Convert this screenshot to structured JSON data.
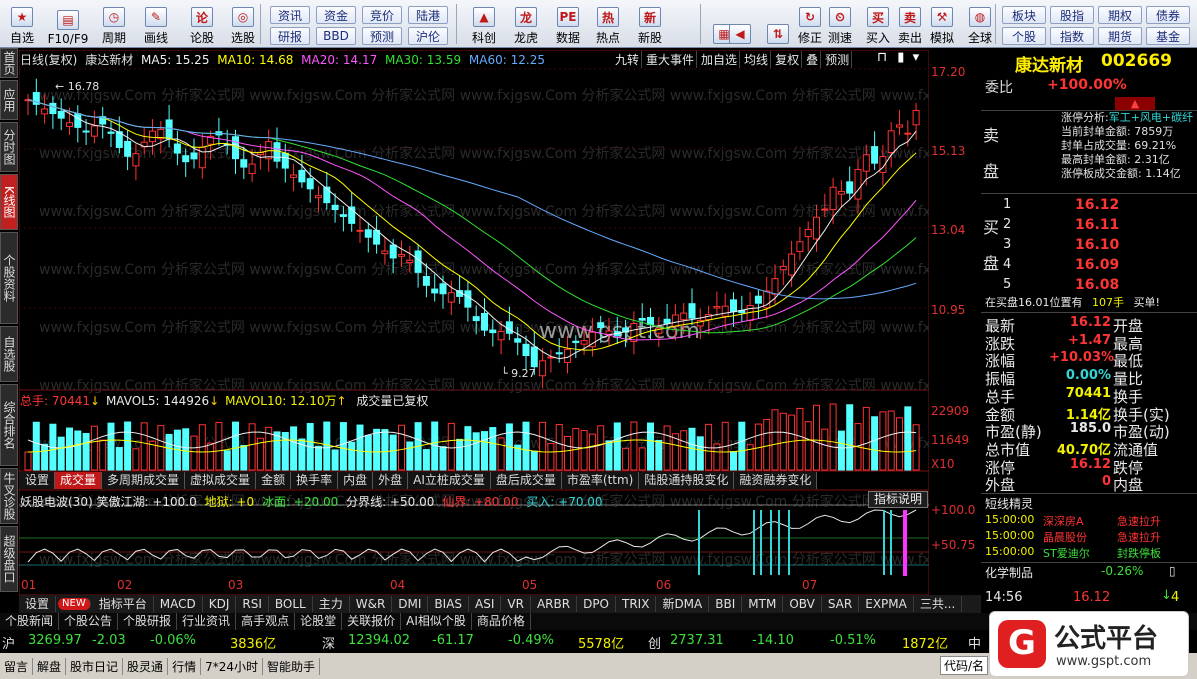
{
  "toolbar": {
    "buttons": [
      {
        "label": "自选",
        "icon": "star-icon",
        "glyph": "★"
      },
      {
        "label": "F10/F9",
        "icon": "f10-icon",
        "glyph": "▤"
      },
      {
        "label": "周期",
        "icon": "clock-icon",
        "glyph": "◷"
      },
      {
        "label": "画线",
        "icon": "pen-icon",
        "glyph": "✎"
      },
      {
        "label": "论股",
        "icon": "discuss-icon",
        "glyph": "论"
      },
      {
        "label": "选股",
        "icon": "select-stock-icon",
        "glyph": "◎"
      },
      {
        "label": "科创",
        "icon": "sci-tech-icon",
        "glyph": "▲"
      },
      {
        "label": "龙虎",
        "icon": "dragon-tiger-icon",
        "glyph": "龙"
      },
      {
        "label": "数据",
        "icon": "data-icon",
        "glyph": "PE"
      },
      {
        "label": "热点",
        "icon": "hot-icon",
        "glyph": "热"
      },
      {
        "label": "新股",
        "icon": "new-stock-icon",
        "glyph": "新"
      },
      {
        "label": "",
        "icon": "layout-icon",
        "glyph": "▦"
      },
      {
        "label": "",
        "icon": "back-arrow-icon",
        "glyph": "◀"
      },
      {
        "label": "",
        "icon": "updown-arrow-icon",
        "glyph": "⇅"
      },
      {
        "label": "修正",
        "icon": "correct-icon",
        "glyph": "↻"
      },
      {
        "label": "测速",
        "icon": "speed-icon",
        "glyph": "⏲"
      },
      {
        "label": "买入",
        "icon": "buy-icon",
        "glyph": "买"
      },
      {
        "label": "卖出",
        "icon": "sell-icon",
        "glyph": "卖"
      },
      {
        "label": "模拟",
        "icon": "hammer-icon",
        "glyph": "⚒"
      },
      {
        "label": "全球",
        "icon": "globe-icon",
        "glyph": "◍"
      }
    ],
    "quick_buttons": [
      "资讯",
      "资金",
      "竞价",
      "陆港",
      "研报",
      "BBD",
      "预测",
      "沪伦",
      "板块",
      "股指",
      "期权",
      "债券",
      "个股",
      "指数",
      "期货",
      "基金"
    ]
  },
  "left_tabs": [
    {
      "label": "首页",
      "active": false
    },
    {
      "label": "应用",
      "active": false
    },
    {
      "label": "分时图",
      "active": false
    },
    {
      "label": "K线图",
      "active": true
    },
    {
      "label": "个股资料",
      "active": false
    },
    {
      "label": "自选股",
      "active": false
    },
    {
      "label": "综合排名",
      "active": false
    },
    {
      "label": "牛叉诊股",
      "active": false
    },
    {
      "label": "超级盘口",
      "active": false
    }
  ],
  "kline": {
    "header": {
      "type": "日线(复权)",
      "name": "康达新材",
      "ma5": "MA5: 15.25",
      "ma10": "MA10: 14.68",
      "ma20": "MA20: 14.17",
      "ma30": "MA30: 13.59",
      "ma60": "MA60: 12.25"
    },
    "header_colors": {
      "ma5": "#f0f0f0",
      "ma10": "#ffff00",
      "ma20": "#ff55ff",
      "ma30": "#33e033",
      "ma60": "#66aaff"
    },
    "header_buttons": [
      "九转",
      "重大事件",
      "加自选",
      "均线",
      "复权",
      "叠",
      "预测"
    ],
    "price_axis": [
      "17.20",
      "15.13",
      "13.04",
      "10.95"
    ],
    "high_label": "16.78",
    "low_label": "9.27",
    "watermark": "www.gspt.com",
    "bg_watermark": "www.fxjgsw.Com 分析家公式网"
  },
  "volume": {
    "header": {
      "total": "总手: 70441",
      "mavol5": "MAVOL5: 144926",
      "mavol10": "MAVOL10: 12.10万",
      "note": "成交量已复权"
    },
    "axis": [
      "22909",
      "11649",
      "X10"
    ]
  },
  "indicator_tabs": [
    "设置",
    "成交量",
    "多周期成交量",
    "虚拟成交量",
    "金额",
    "换手率",
    "内盘",
    "外盘",
    "AI立桩成交量",
    "盘后成交量",
    "市盈率(ttm)",
    "陆股通持股变化",
    "融资融券变化"
  ],
  "oscillator": {
    "header": {
      "name": "妖股电波(30)",
      "a": "笑傲江湖: +100.0",
      "b": "地狱: +0",
      "c": "冰面: +20.00",
      "d": "分界线: +50.00",
      "e": "仙界: +80.00",
      "f": "买入: +70.00"
    },
    "button": "指标说明",
    "axis": [
      "+100.0",
      "+50.75"
    ]
  },
  "months": [
    "01",
    "02",
    "03",
    "04",
    "05",
    "06",
    "07"
  ],
  "bottom_tabs": [
    "设置",
    "NEW",
    "指标平台",
    "MACD",
    "KDJ",
    "RSI",
    "BOLL",
    "主力",
    "W&R",
    "DMI",
    "BIAS",
    "ASI",
    "VR",
    "ARBR",
    "DPO",
    "TRIX",
    "新DMA",
    "BBI",
    "MTM",
    "OBV",
    "SAR",
    "EXPMA",
    "三共..."
  ],
  "info_tabs": [
    "个股新闻",
    "个股公告",
    "个股研报",
    "行业资讯",
    "高手观点",
    "论股堂",
    "关联报价",
    "AI相似个股",
    "商品价格"
  ],
  "right_panel": {
    "name": "康达新材",
    "code": "002669",
    "weibi_label": "委比",
    "weibi_value": "+100.00%",
    "sell_label": "卖盘",
    "buy_label": "买盘",
    "zt_analysis": {
      "title": "涨停分析:",
      "tags": "军工+风电+碳纤",
      "lines": [
        "当前封单金额: 7859万",
        "封单占成交量: 69.21%",
        "最高封单金额: 2.31亿",
        "涨停板成交金额: 1.14亿"
      ]
    },
    "bids": [
      {
        "level": "1",
        "price": "16.12"
      },
      {
        "level": "2",
        "price": "16.11"
      },
      {
        "level": "3",
        "price": "16.10"
      },
      {
        "level": "4",
        "price": "16.09"
      },
      {
        "level": "5",
        "price": "16.08"
      }
    ],
    "queue": {
      "text": "在买盘16.01位置有",
      "qty": "107手",
      "suffix": "买单!"
    },
    "stats": [
      {
        "k1": "最新",
        "v1": "16.12",
        "k2": "开盘",
        "v1c": "r"
      },
      {
        "k1": "涨跌",
        "v1": "+1.47",
        "k2": "最高",
        "v1c": "r"
      },
      {
        "k1": "涨幅",
        "v1": "+10.03%",
        "k2": "最低",
        "v1c": "r"
      },
      {
        "k1": "振幅",
        "v1": "0.00%",
        "k2": "量比",
        "v1c": "c"
      },
      {
        "k1": "总手",
        "v1": "70441",
        "k2": "换手",
        "v1c": "y"
      },
      {
        "k1": "金额",
        "v1": "1.14亿",
        "k2": "换手(实)",
        "v1c": "y"
      },
      {
        "k1": "市盈(静)",
        "v1": "185.0",
        "k2": "市盈(动)",
        "v1c": "w"
      },
      {
        "k1": "总市值",
        "v1": "40.70亿",
        "k2": "流通值",
        "v1c": "y"
      },
      {
        "k1": "涨停",
        "v1": "16.12",
        "k2": "跌停",
        "v1c": "r"
      },
      {
        "k1": "外盘",
        "v1": "0",
        "k2": "内盘",
        "v1c": "r"
      }
    ],
    "short_title": "短线精灵",
    "short_items": [
      {
        "time": "15:00:00",
        "name": "深深房A",
        "event": "急速拉升"
      },
      {
        "time": "15:00:00",
        "name": "晶晨股份",
        "event": "急速拉升"
      },
      {
        "time": "15:00:00",
        "name": "ST爱迪尔",
        "event": "封跌停板"
      }
    ],
    "industry": "化学制品",
    "industry_chg": "-0.26%",
    "tick_time": "14:56",
    "tick_price": "16.12",
    "tick_vol": "4"
  },
  "index_bar": [
    {
      "name": "沪",
      "value": "3269.97",
      "chg": "-2.03",
      "pct": "-0.06%",
      "amt": "3836亿"
    },
    {
      "name": "深",
      "value": "12394.02",
      "chg": "-61.17",
      "pct": "-0.49%",
      "amt": "5578亿"
    },
    {
      "name": "创",
      "value": "2737.31",
      "chg": "-14.10",
      "pct": "-0.51%",
      "amt": "1872亿"
    }
  ],
  "index_tail": "中",
  "status_items": [
    "留言",
    "解盘",
    "股市日记",
    "股灵通",
    "行情",
    "7*24小时",
    "智能助手"
  ],
  "status_right": "代码/名",
  "brand": {
    "name": "公式平台",
    "url": "www.gspt.com"
  }
}
